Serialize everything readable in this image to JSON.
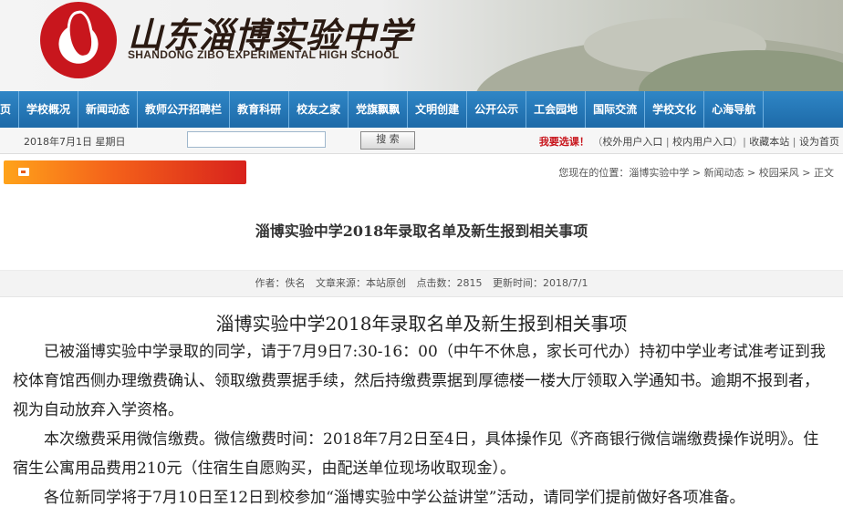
{
  "banner": {
    "school_name_cn": "山东淄博实验中学",
    "school_name_en": "SHANDONG ZIBO EXPERIMENTAL HIGH SCHOOL"
  },
  "nav": {
    "items": [
      "页",
      "学校概况",
      "新闻动态",
      "教师公开招聘栏",
      "教育科研",
      "校友之家",
      "党旗飘飘",
      "文明创建",
      "公开公示",
      "工会园地",
      "国际交流",
      "学校文化",
      "心海导航"
    ]
  },
  "utility": {
    "date": "2018年7月1日 星期日",
    "search_value": "",
    "search_button": "搜 索",
    "welcome_prefix": "我要选课",
    "welcome_suffix": "！",
    "links": [
      "校外用户入口",
      "校内用户入口",
      "收藏本站",
      "设为首页"
    ]
  },
  "location": {
    "label": "您现在的位置：",
    "crumbs": [
      "淄博实验中学",
      "新闻动态",
      "校园采风",
      "正文"
    ]
  },
  "article": {
    "title": "淄博实验中学2018年录取名单及新生报到相关事项",
    "meta": {
      "author": "作者：佚名",
      "source": "文章来源：本站原创",
      "hits": "点击数：2815",
      "updated": "更新时间：2018/7/1"
    },
    "heading": "淄博实验中学2018年录取名单及新生报到相关事项",
    "paragraphs": [
      "已被淄博实验中学录取的同学，请于7月9日7:30-16：00（中午不休息，家长可代办）持初中学业考试准考证到我校体育馆西侧办理缴费确认、领取缴费票据手续，然后持缴费票据到厚德楼一楼大厅领取入学通知书。逾期不报到者，视为自动放弃入学资格。",
      "本次缴费采用微信缴费。微信缴费时间：2018年7月2日至4日，具体操作见《齐商银行微信端缴费操作说明》。住宿生公寓用品费用210元（住宿生自愿购买，由配送单位现场收取现金）。",
      "各位新同学将于7月10日至12日到校参加“淄博实验中学公益讲堂”活动，请同学们提前做好各项准备。"
    ]
  },
  "colors": {
    "nav_blue": "#1d6aa8",
    "brand_red": "#c8161d",
    "orange_bar": "#f4611a"
  }
}
